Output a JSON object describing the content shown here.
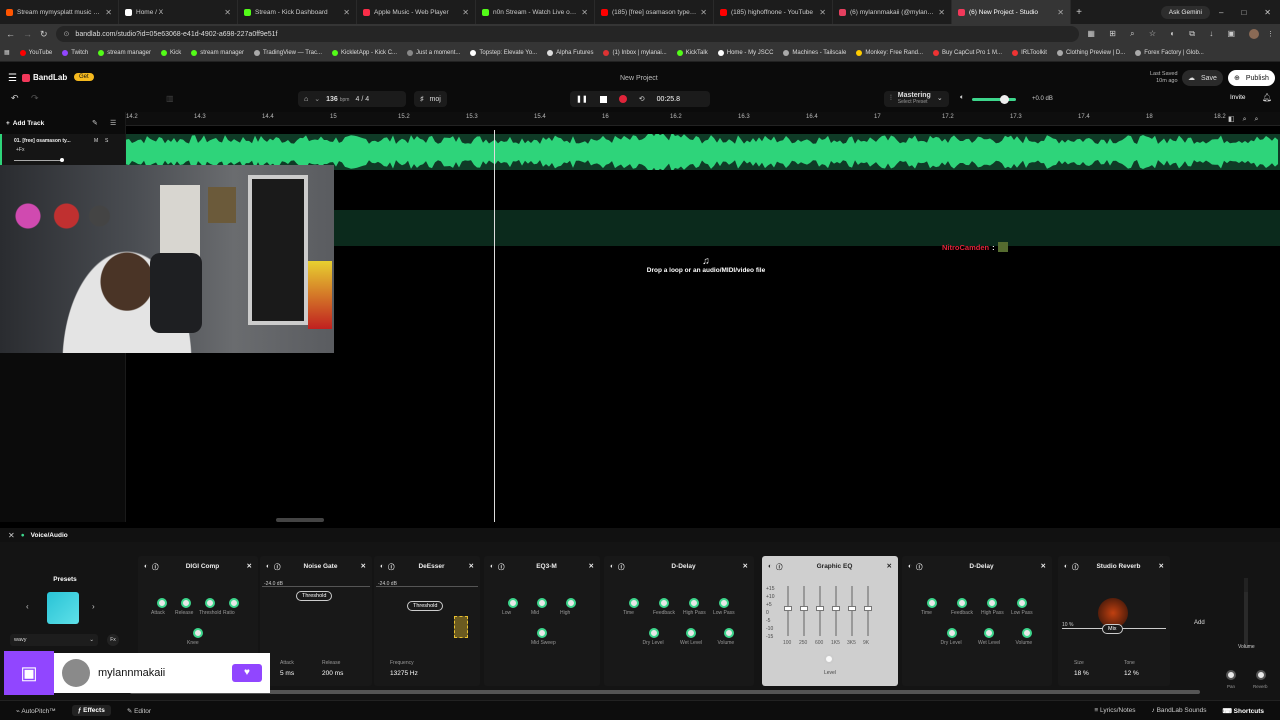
{
  "browser": {
    "tabs": [
      {
        "title": "Stream mymysplatt music | Listen",
        "color": "#ff5500",
        "active": false
      },
      {
        "title": "Home / X",
        "color": "#ffffff",
        "active": false
      },
      {
        "title": "Stream - Kick Dashboard",
        "color": "#53fc18",
        "active": false
      },
      {
        "title": "Apple Music - Web Player",
        "color": "#fa2d48",
        "active": false
      },
      {
        "title": "n0n Stream - Watch Live on Kick",
        "color": "#53fc18",
        "active": false
      },
      {
        "title": "(185) [free] osamason type beat",
        "color": "#ff0000",
        "active": false
      },
      {
        "title": "(185) highoffnone - YouTube",
        "color": "#ff0000",
        "active": false
      },
      {
        "title": "(6) mylannmakaii (@mylannmakaii)",
        "color": "#e4405f",
        "active": false
      },
      {
        "title": "(6) New Project - Studio",
        "color": "#f2385a",
        "active": true
      }
    ],
    "ask_gemini": "Ask Gemini",
    "url": "bandlab.com/studio?id=05e63068-e41d-4902-a698-227a0ff9e51f",
    "bookmarks": [
      "YouTube",
      "Twitch",
      "stream manager",
      "Kick",
      "stream manager",
      "TradingView — Trac...",
      "KickletApp - Kick C...",
      "Just a moment...",
      "Topstep: Elevate Yo...",
      "Alpha Futures",
      "(1) Inbox | mylanai...",
      "KickTalk",
      "Home - My JSCC",
      "Machines - Tailscale",
      "Monkey: Free Rand...",
      "Buy CapCut Pro 1 M...",
      "IRLToolkit",
      "Clothing Preview | D...",
      "Forex Factory | Glob..."
    ]
  },
  "app": {
    "logo": "BandLab",
    "get_label": "Get",
    "project_title": "New Project",
    "last_saved": "Last Saved",
    "last_saved_ago": "10m ago",
    "save_label": "Save",
    "publish_label": "Publish",
    "invite_label": "Invite"
  },
  "transport": {
    "bpm": "136",
    "bpm_unit": "bpm",
    "time_signature": "4 / 4",
    "key": "moj",
    "time": "00:25.8",
    "mastering_label": "Mastering",
    "mastering_sub": "Select Preset",
    "master_volume": "+0.0 dB"
  },
  "track_area": {
    "add_track": "Add Track",
    "track_name": "01. [free] osamason ty...",
    "track_fx": "+Fx",
    "drop_hint": "Drop a loop or an audio/MIDI/video file",
    "chat_user": "NitroCamden",
    "ruler_ticks": [
      "14.2",
      "14.3",
      "14.4",
      "15",
      "15.2",
      "15.3",
      "15.4",
      "16",
      "16.2",
      "16.3",
      "16.4",
      "17",
      "17.2",
      "17.3",
      "17.4",
      "18",
      "18.2"
    ]
  },
  "effects": {
    "panel_title": "Voice/Audio",
    "presets_label": "Presets",
    "preset_name": "wavy",
    "plugins": [
      {
        "name": "DIGI Comp",
        "knobs": [
          "Attack",
          "Release",
          "Threshold",
          "Ratio",
          "Knee"
        ]
      },
      {
        "name": "Noise Gate",
        "threshold": "Threshold",
        "db": "-24.0 dB",
        "attack_label": "Attack",
        "attack": "5 ms",
        "release_label": "Release",
        "release": "200 ms"
      },
      {
        "name": "DeEsser",
        "threshold": "Threshold",
        "db": "-24.0 dB",
        "freq_label": "Frequency",
        "freq": "13275 Hz"
      },
      {
        "name": "EQ3-M",
        "knobs": [
          "Low",
          "Mid",
          "High",
          "Mid Sweep"
        ]
      },
      {
        "name": "D-Delay",
        "knobs": [
          "Time",
          "Feedback",
          "High Pass",
          "Low Pass",
          "Dry Level",
          "Wet Level",
          "Volume"
        ]
      },
      {
        "name": "Graphic EQ",
        "bands": [
          "100",
          "250",
          "600",
          "1K5",
          "3K5",
          "9K"
        ],
        "scale": [
          "+15",
          "+10",
          "+5",
          "0",
          "-5",
          "-10",
          "-15"
        ],
        "level": "Level"
      },
      {
        "name": "D-Delay",
        "knobs": [
          "Time",
          "Feedback",
          "High Pass",
          "Low Pass",
          "Dry Level",
          "Wet Level",
          "Volume"
        ]
      },
      {
        "name": "Studio Reverb",
        "mix": "Mix",
        "mix_pct": "10 %",
        "size_label": "Size",
        "size": "18 %",
        "tone_label": "Tone",
        "tone": "12 %"
      }
    ],
    "add_label": "Add",
    "volume_label": "Volume",
    "pan_label": "Pan",
    "reverb_label": "Reverb"
  },
  "twitch_overlay": {
    "username": "mylannmakaii"
  },
  "footer": {
    "autopitch": "AutoPitch™",
    "effects": "Effects",
    "editor": "Editor",
    "lyrics": "Lyrics/Notes",
    "sounds": "BandLab Sounds",
    "shortcuts": "Shortcuts"
  },
  "colors": {
    "accent": "#3dd68c",
    "brand_red": "#f2385a",
    "waveform": "#2ed47a",
    "get_badge": "#f5b91e",
    "twitch": "#9146ff"
  }
}
